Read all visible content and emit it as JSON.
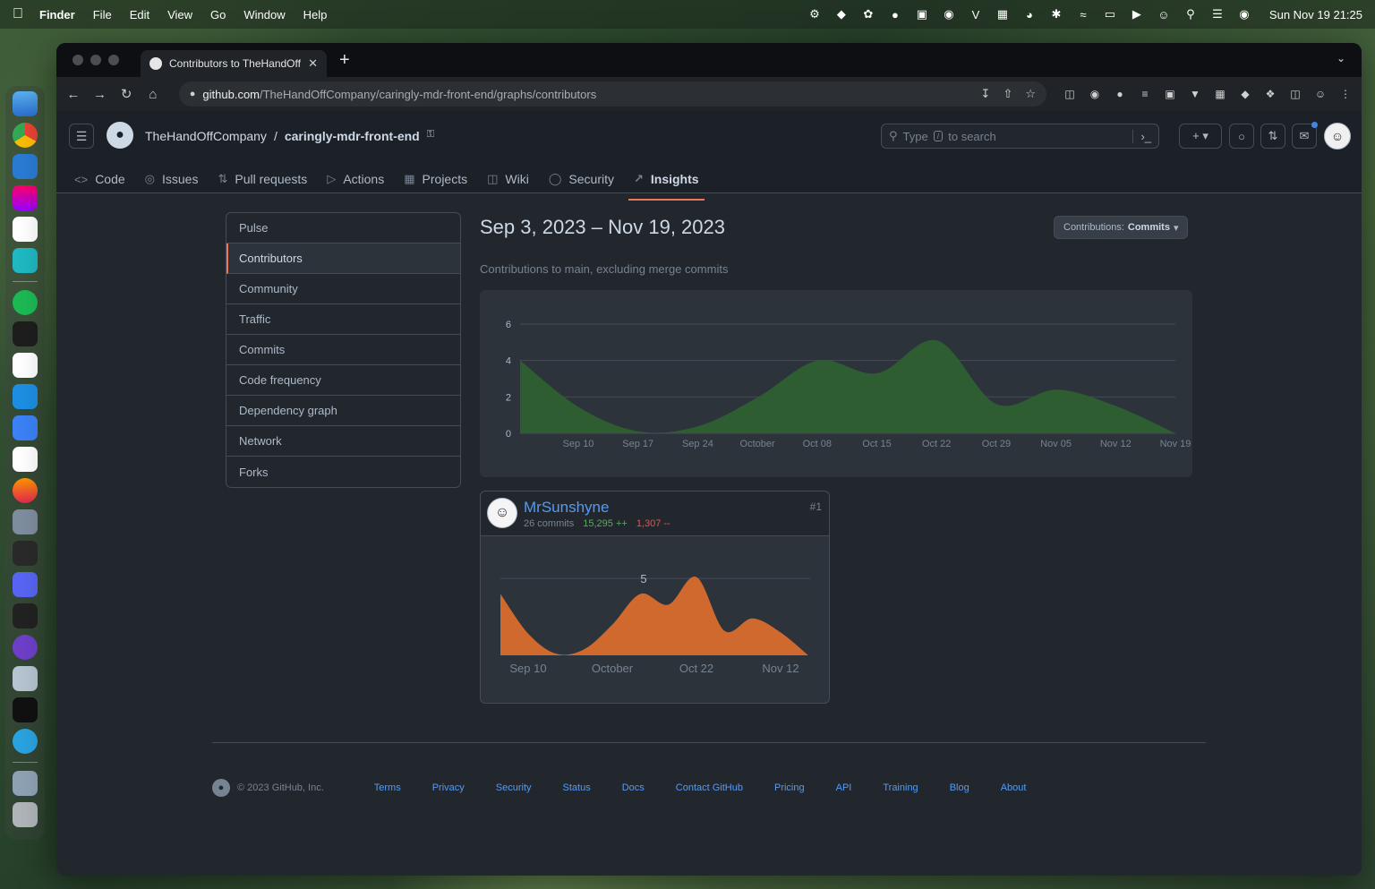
{
  "menubar": {
    "app": "Finder",
    "items": [
      "File",
      "Edit",
      "View",
      "Go",
      "Window",
      "Help"
    ],
    "clock": "Sun Nov 19  21:25"
  },
  "browser": {
    "tab_title": "Contributors to TheHandOffCompany",
    "url_host": "github.com",
    "url_path": "/TheHandOffCompany/caringly-mdr-front-end/graphs/contributors"
  },
  "header": {
    "owner": "TheHandOffCompany",
    "separator": "/",
    "repo": "caringly-mdr-front-end",
    "search_placeholder": "Type / to search",
    "search_prefix": "Type",
    "search_key": "/",
    "search_suffix": "to search"
  },
  "repo_nav": [
    {
      "label": "Code",
      "icon": "code-icon"
    },
    {
      "label": "Issues",
      "icon": "issue-icon"
    },
    {
      "label": "Pull requests",
      "icon": "pull-request-icon"
    },
    {
      "label": "Actions",
      "icon": "play-icon"
    },
    {
      "label": "Projects",
      "icon": "table-icon"
    },
    {
      "label": "Wiki",
      "icon": "book-icon"
    },
    {
      "label": "Security",
      "icon": "shield-icon"
    },
    {
      "label": "Insights",
      "icon": "graph-icon"
    }
  ],
  "sidebar": {
    "items": [
      "Pulse",
      "Contributors",
      "Community",
      "Traffic",
      "Commits",
      "Code frequency",
      "Dependency graph",
      "Network",
      "Forks"
    ],
    "selected": "Contributors"
  },
  "main": {
    "range": "Sep 3, 2023 – Nov 19, 2023",
    "contrib_button_prefix": "Contributions:",
    "contrib_button_value": "Commits",
    "subtitle": "Contributions to main, excluding merge commits"
  },
  "chart_data": [
    {
      "type": "area",
      "title": "",
      "x": [
        "Sep 03",
        "Sep 10",
        "Sep 17",
        "Sep 24",
        "Oct 01",
        "Oct 08",
        "Oct 15",
        "Oct 22",
        "Oct 29",
        "Nov 05",
        "Nov 12",
        "Nov 19"
      ],
      "x_tick_labels": [
        "Sep 10",
        "Sep 17",
        "Sep 24",
        "October",
        "Oct 08",
        "Oct 15",
        "Oct 22",
        "Oct 29",
        "Nov 05",
        "Nov 12",
        "Nov 19"
      ],
      "series": [
        {
          "values": [
            4,
            1.4,
            0.1,
            0.4,
            2.0,
            4.0,
            3.3,
            5.1,
            1.6,
            2.4,
            1.5,
            0
          ]
        }
      ],
      "y_ticks": [
        0,
        2,
        4,
        6
      ],
      "ylim": [
        0,
        6
      ],
      "grid": true,
      "color": "#2f5d32"
    },
    {
      "type": "area",
      "title": "",
      "x": [
        "Sep 03",
        "Sep 10",
        "Sep 17",
        "Sep 24",
        "Oct 01",
        "Oct 08",
        "Oct 15",
        "Oct 22",
        "Oct 29",
        "Nov 05",
        "Nov 12",
        "Nov 19"
      ],
      "x_tick_labels": [
        "Sep 10",
        "October",
        "Oct 22",
        "Nov 12"
      ],
      "series": [
        {
          "values": [
            4,
            1.4,
            0.1,
            0.4,
            2.0,
            4.0,
            3.3,
            5.1,
            1.6,
            2.4,
            1.5,
            0
          ]
        }
      ],
      "y_ticks": [
        5
      ],
      "ylim": [
        0,
        6
      ],
      "grid": true,
      "color": "#d0692d"
    }
  ],
  "contributor": {
    "name": "MrSunshyne",
    "commits": "26 commits",
    "additions": "15,295 ++",
    "deletions": "1,307 --",
    "rank": "#1"
  },
  "footer": {
    "copyright": "© 2023 GitHub, Inc.",
    "links": [
      "Terms",
      "Privacy",
      "Security",
      "Status",
      "Docs",
      "Contact GitHub",
      "Pricing",
      "API",
      "Training",
      "Blog",
      "About"
    ]
  }
}
